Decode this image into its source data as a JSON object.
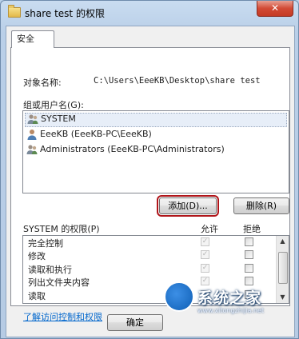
{
  "window": {
    "title": "share test 的权限",
    "close_label": "✕"
  },
  "tabs": [
    {
      "label": "安全"
    }
  ],
  "object": {
    "label": "对象名称:",
    "value": "C:\\Users\\EeeKB\\Desktop\\share test"
  },
  "users": {
    "label": "组或用户名(G):",
    "items": [
      {
        "name": "SYSTEM",
        "selected": true
      },
      {
        "name": "EeeKB (EeeKB-PC\\EeeKB)",
        "selected": false
      },
      {
        "name": "Administrators (EeeKB-PC\\Administrators)",
        "selected": false
      }
    ]
  },
  "buttons": {
    "add": "添加(D)...",
    "remove": "删除(R)",
    "ok": "确定"
  },
  "permissions": {
    "label": "SYSTEM 的权限(P)",
    "allow_header": "允许",
    "deny_header": "拒绝",
    "items": [
      {
        "name": "完全控制",
        "allow": true,
        "deny": false
      },
      {
        "name": "修改",
        "allow": true,
        "deny": false
      },
      {
        "name": "读取和执行",
        "allow": true,
        "deny": false
      },
      {
        "name": "列出文件夹内容",
        "allow": true,
        "deny": false
      },
      {
        "name": "读取",
        "allow": true,
        "deny": false
      }
    ]
  },
  "link": {
    "label": "了解访问控制和权限"
  },
  "watermark": {
    "text": "系统之家",
    "url": "www.xitongzhijia.net"
  }
}
